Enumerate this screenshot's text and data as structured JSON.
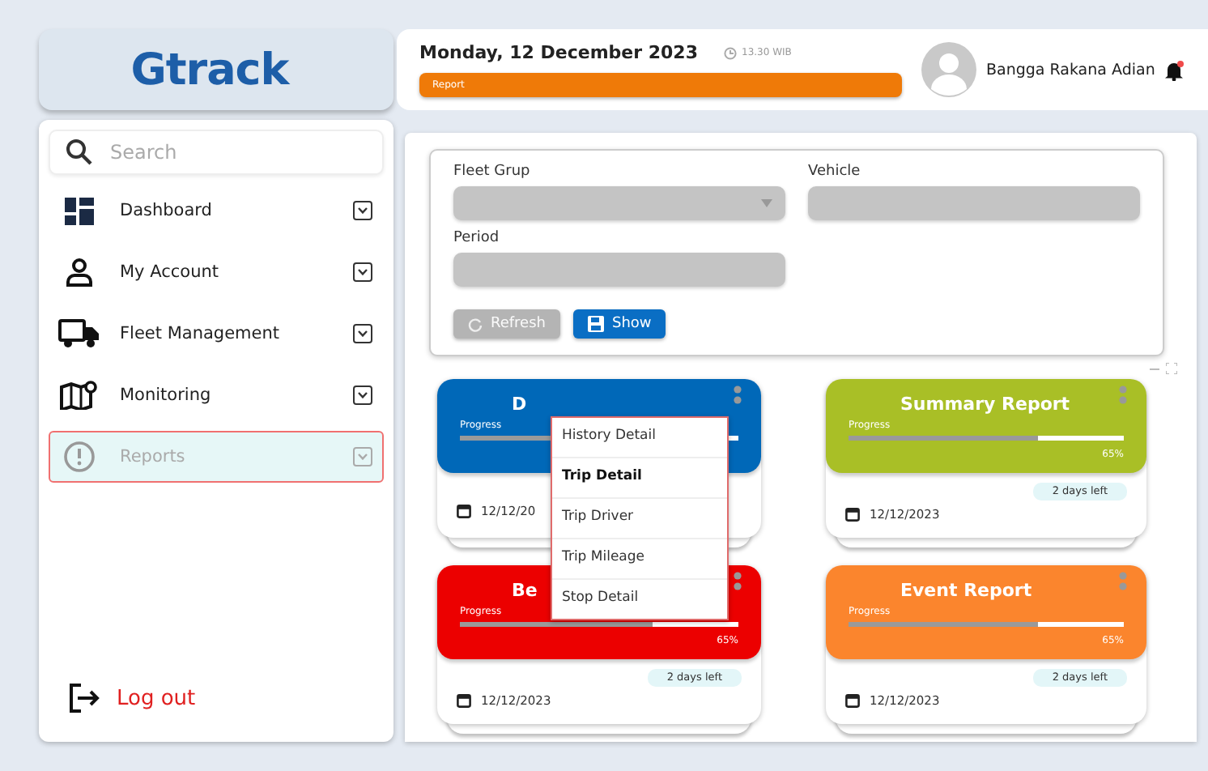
{
  "logo": "Gtrack",
  "header": {
    "date": "Monday, 12 December 2023",
    "time": "13.30 WIB",
    "banner": "Report",
    "user": "Bangga Rakana Adian",
    "notification": true
  },
  "sidebar": {
    "search": {
      "placeholder": "Search"
    },
    "items": [
      {
        "label": "Dashboard",
        "selected": false
      },
      {
        "label": "My Account",
        "selected": false
      },
      {
        "label": "Fleet Management",
        "selected": false
      },
      {
        "label": "Monitoring",
        "selected": false
      },
      {
        "label": "Reports",
        "selected": true
      }
    ],
    "logout": "Log out"
  },
  "filter": {
    "fields": [
      {
        "label": "Fleet Grup",
        "kind": "select"
      },
      {
        "label": "Vehicle",
        "kind": "text"
      },
      {
        "label": "Period",
        "kind": "text"
      }
    ],
    "buttons": [
      {
        "label": "Refresh",
        "disabled": true
      },
      {
        "label": "Show",
        "disabled": false
      }
    ]
  },
  "cards": [
    {
      "title": "D",
      "color": "#0068b8",
      "progress_label": "Progress",
      "level": 0.69,
      "date": "12/12/20"
    },
    {
      "title": "Summary Report",
      "color": "#a9bf26",
      "progress_label": "Progress",
      "level": 0.69,
      "percent": "65%",
      "days_left": "2 days left",
      "date": "12/12/2023"
    },
    {
      "title": "Be",
      "color": "#ec0000",
      "progress_label": "Progress",
      "level": 0.69,
      "percent": "65%",
      "days_left": "2 days left",
      "date": "12/12/2023"
    },
    {
      "title": "Event Report",
      "color": "#fb852d",
      "progress_label": "Progress",
      "level": 0.69,
      "percent": "65%",
      "days_left": "2 days left",
      "date": "12/12/2023"
    }
  ],
  "menu": {
    "items": [
      {
        "label": "History Detail",
        "selected": false
      },
      {
        "label": "Trip Detail",
        "selected": true
      },
      {
        "label": "Trip Driver",
        "selected": false
      },
      {
        "label": "Trip Mileage",
        "selected": false
      },
      {
        "label": "Stop Detail",
        "selected": false
      }
    ]
  }
}
